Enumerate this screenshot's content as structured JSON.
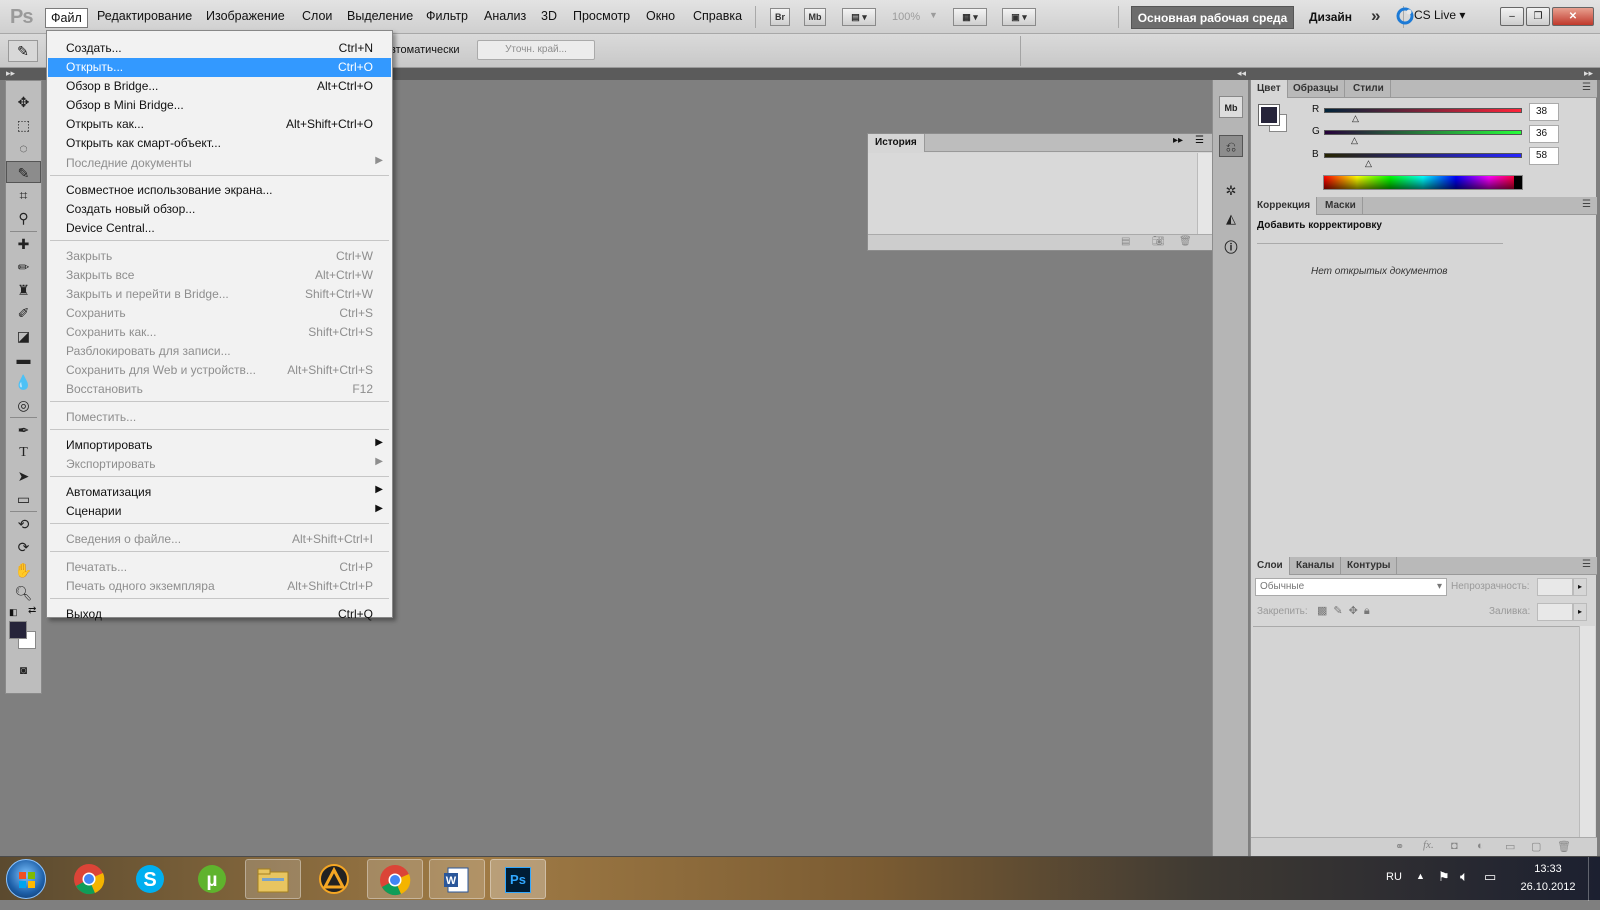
{
  "menubar": {
    "logo": "Ps",
    "items": [
      "Файл",
      "Редактирование",
      "Изображение",
      "Слои",
      "Выделение",
      "Фильтр",
      "Анализ",
      "3D",
      "Просмотр",
      "Окно",
      "Справка"
    ],
    "bridge_btn": "Br",
    "minibridge_btn": "Mb",
    "zoom": "100%",
    "workspace": "Основная рабочая среда",
    "design": "Дизайн",
    "cslive": "CS Live"
  },
  "options": {
    "auto_label": "втоматически",
    "refine_edge": "Уточн. край..."
  },
  "file_menu": {
    "items": [
      {
        "label": "Создать...",
        "shortcut": "Ctrl+N",
        "disabled": false
      },
      {
        "label": "Открыть...",
        "shortcut": "Ctrl+O",
        "disabled": false,
        "highlighted": true
      },
      {
        "label": "Обзор в Bridge...",
        "shortcut": "Alt+Ctrl+O",
        "disabled": false
      },
      {
        "label": "Обзор в Mini Bridge...",
        "shortcut": "",
        "disabled": false
      },
      {
        "label": "Открыть как...",
        "shortcut": "Alt+Shift+Ctrl+O",
        "disabled": false
      },
      {
        "label": "Открыть как смарт-объект...",
        "shortcut": "",
        "disabled": false
      },
      {
        "label": "Последние документы",
        "shortcut": "",
        "disabled": true,
        "submenu": true
      },
      {
        "label": "Совместное использование экрана...",
        "shortcut": "",
        "disabled": false
      },
      {
        "label": "Создать новый обзор...",
        "shortcut": "",
        "disabled": false
      },
      {
        "label": "Device Central...",
        "shortcut": "",
        "disabled": false
      },
      {
        "label": "Закрыть",
        "shortcut": "Ctrl+W",
        "disabled": true
      },
      {
        "label": "Закрыть все",
        "shortcut": "Alt+Ctrl+W",
        "disabled": true
      },
      {
        "label": "Закрыть и перейти в Bridge...",
        "shortcut": "Shift+Ctrl+W",
        "disabled": true
      },
      {
        "label": "Сохранить",
        "shortcut": "Ctrl+S",
        "disabled": true
      },
      {
        "label": "Сохранить как...",
        "shortcut": "Shift+Ctrl+S",
        "disabled": true
      },
      {
        "label": "Разблокировать для записи...",
        "shortcut": "",
        "disabled": true
      },
      {
        "label": "Сохранить для Web и устройств...",
        "shortcut": "Alt+Shift+Ctrl+S",
        "disabled": true
      },
      {
        "label": "Восстановить",
        "shortcut": "F12",
        "disabled": true
      },
      {
        "label": "Поместить...",
        "shortcut": "",
        "disabled": true
      },
      {
        "label": "Импортировать",
        "shortcut": "",
        "disabled": false,
        "submenu": true
      },
      {
        "label": "Экспортировать",
        "shortcut": "",
        "disabled": true,
        "submenu": true
      },
      {
        "label": "Автоматизация",
        "shortcut": "",
        "disabled": false,
        "submenu": true
      },
      {
        "label": "Сценарии",
        "shortcut": "",
        "disabled": false,
        "submenu": true
      },
      {
        "label": "Сведения о файле...",
        "shortcut": "Alt+Shift+Ctrl+I",
        "disabled": true
      },
      {
        "label": "Печатать...",
        "shortcut": "Ctrl+P",
        "disabled": true
      },
      {
        "label": "Печать одного экземпляра",
        "shortcut": "Alt+Shift+Ctrl+P",
        "disabled": true
      },
      {
        "label": "Выход",
        "shortcut": "Ctrl+Q",
        "disabled": false
      }
    ]
  },
  "history_panel": {
    "tab": "История"
  },
  "color_panel": {
    "tabs": [
      "Цвет",
      "Образцы",
      "Стили"
    ],
    "r_label": "R",
    "g_label": "G",
    "b_label": "B",
    "r": "38",
    "g": "36",
    "b": "58",
    "fg_color": "#26243a"
  },
  "adjustments_panel": {
    "tabs": [
      "Коррекция",
      "Маски"
    ],
    "title": "Добавить корректировку",
    "empty": "Нет открытых документов"
  },
  "layers_panel": {
    "tabs": [
      "Слои",
      "Каналы",
      "Контуры"
    ],
    "blend_mode": "Обычные",
    "opacity_label": "Непрозрачность:",
    "lock_label": "Закрепить:",
    "fill_label": "Заливка:"
  },
  "taskbar": {
    "ps_label": "Ps",
    "lang": "RU",
    "time": "13:33",
    "date": "26.10.2012"
  }
}
